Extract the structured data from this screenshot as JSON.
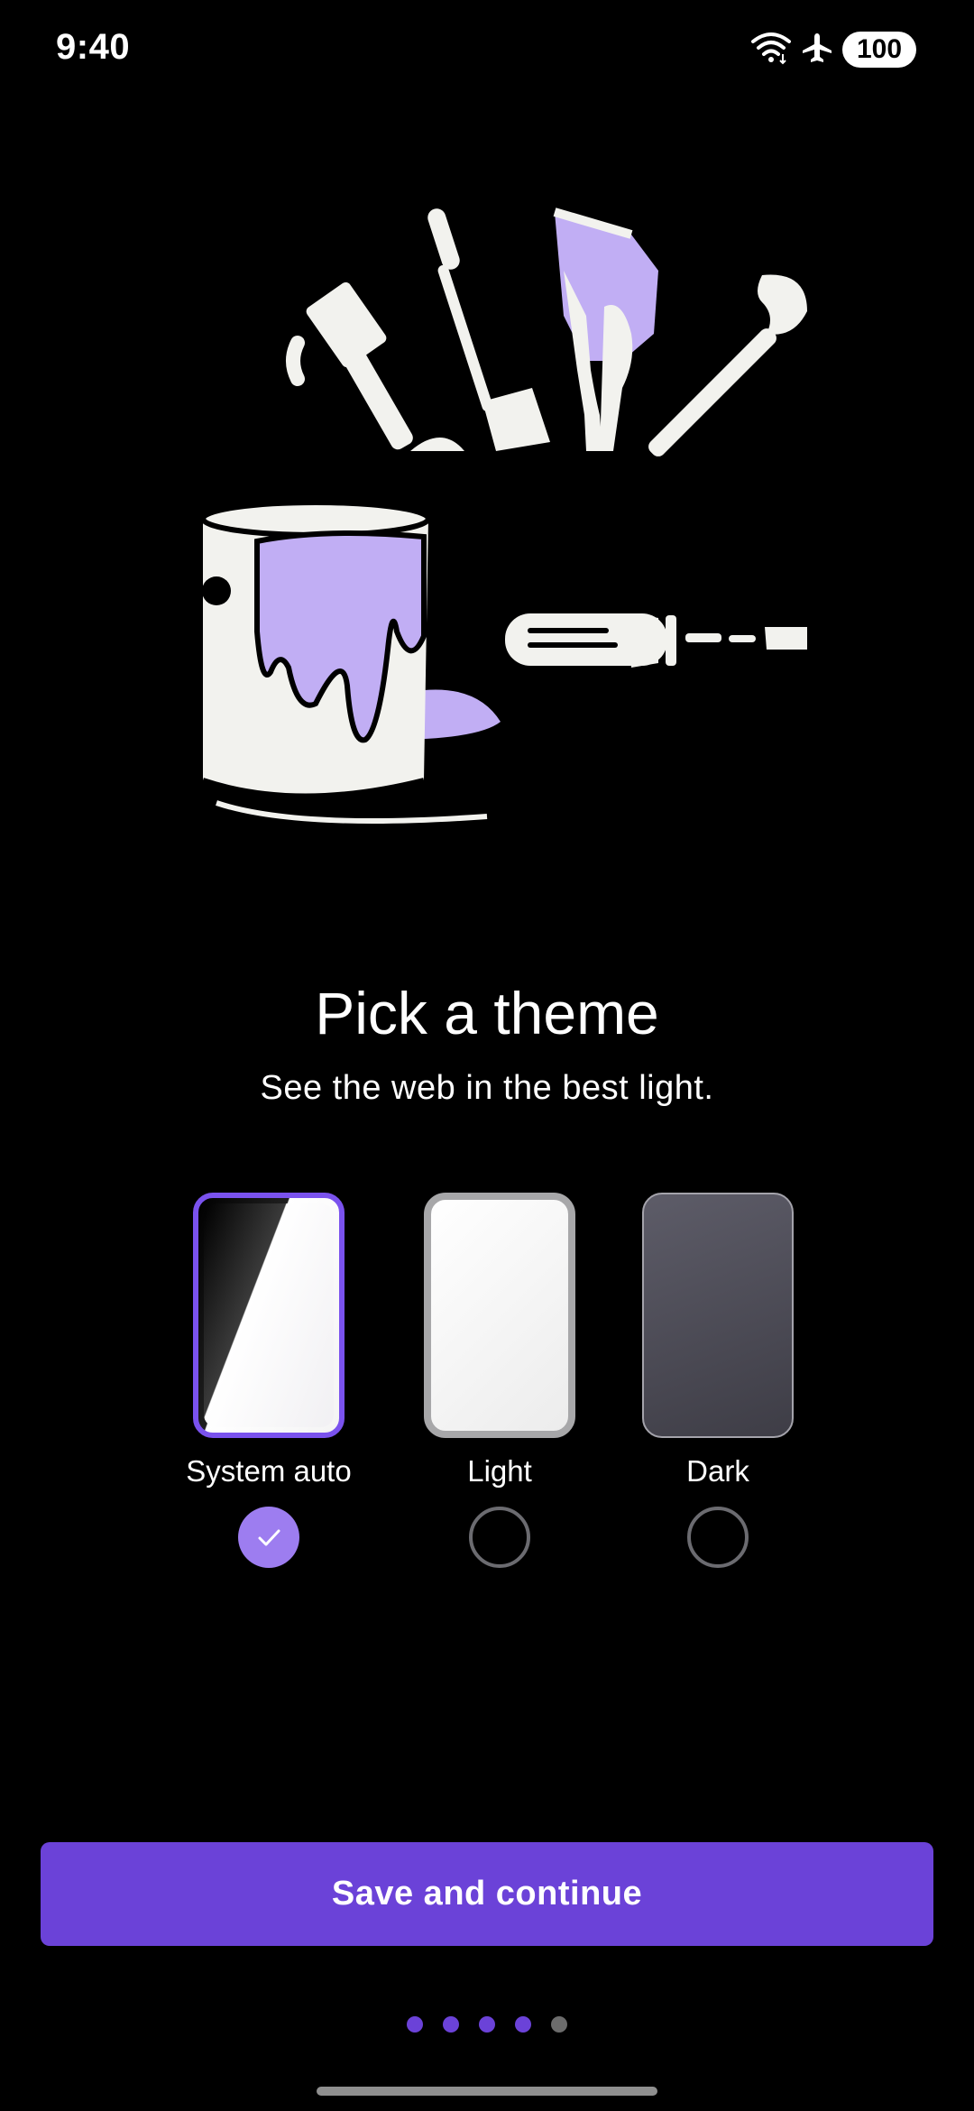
{
  "status_bar": {
    "time": "9:40",
    "battery": "100",
    "icons": [
      "wifi-icon",
      "airplane-icon",
      "battery-icon"
    ]
  },
  "illustration": {
    "name": "paint-and-tools-illustration",
    "accent_color": "#c1aef4"
  },
  "content": {
    "title": "Pick a theme",
    "subtitle": "See the web in the best light."
  },
  "themes": [
    {
      "label": "System auto",
      "selected": true
    },
    {
      "label": "Light",
      "selected": false
    },
    {
      "label": "Dark",
      "selected": false
    }
  ],
  "actions": {
    "save_label": "Save and continue"
  },
  "pager": {
    "total": 5,
    "current": 4
  },
  "colors": {
    "accent": "#6b42d8",
    "selected_radio": "#9d7df0",
    "background": "#000000"
  }
}
